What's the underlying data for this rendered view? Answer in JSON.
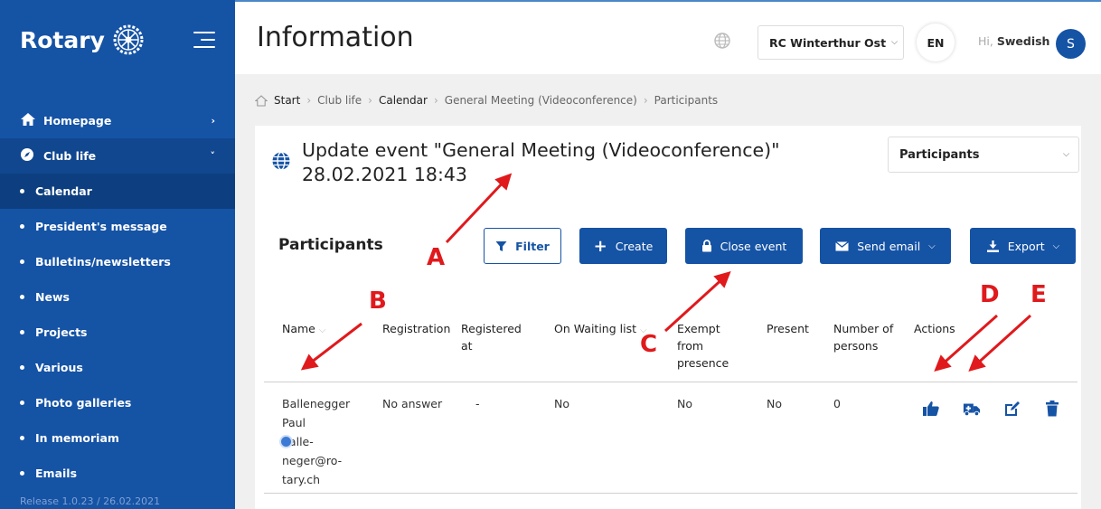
{
  "sidebar": {
    "logo_text": "Rotary",
    "menu": [
      {
        "label": "Homepage",
        "arrow": "›"
      },
      {
        "label": "Club life",
        "arrow": "˅"
      }
    ],
    "submenu": [
      "Calendar",
      "President's message",
      "Bulletins/newsletters",
      "News",
      "Projects",
      "Various",
      "Photo galleries",
      "In memoriam",
      "Emails"
    ],
    "release": "Release 1.0.23 / 26.02.2021"
  },
  "topbar": {
    "title": "Information",
    "club": "RC Winterthur Ost",
    "lang": "EN",
    "greeting": "Hi,",
    "user": "Swedish",
    "avatar": "S"
  },
  "breadcrumb": [
    "Start",
    "Club life",
    "Calendar",
    "General Meeting (Videoconference)",
    "Participants"
  ],
  "event": {
    "title_line1": "Update event \"General Meeting (Videoconference)\"",
    "title_line2": "28.02.2021 18:43",
    "view_select": "Participants"
  },
  "participants": {
    "title": "Participants",
    "buttons": {
      "filter": "Filter",
      "create": "Create",
      "close": "Close event",
      "email": "Send email",
      "export": "Export"
    },
    "columns": [
      "Name",
      "Registration",
      "Registered at",
      "On Waiting list",
      "Exempt from presence",
      "Present",
      "Number of persons",
      "Actions"
    ],
    "rows": [
      {
        "name_lines": [
          "Ballenegger",
          "Paul",
          "balle-",
          "neger@ro-",
          "tary.ch"
        ],
        "registration": "No answer",
        "registered_at": "-",
        "waiting": "No",
        "exempt": "No",
        "present": "No",
        "persons": "0"
      }
    ]
  },
  "annotations": [
    "A",
    "B",
    "C",
    "D",
    "E"
  ],
  "colors": {
    "brand": "#1553a5",
    "annotation": "#e0191c"
  }
}
